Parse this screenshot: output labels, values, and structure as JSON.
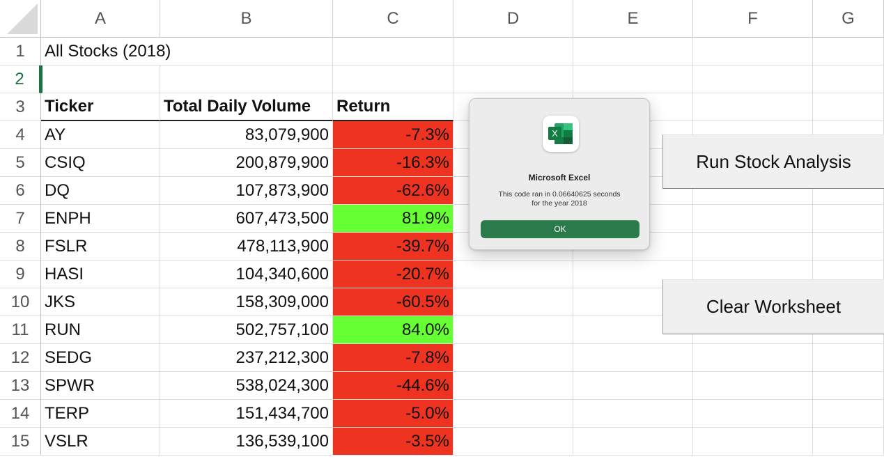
{
  "columns": [
    "A",
    "B",
    "C",
    "D",
    "E",
    "F",
    "G"
  ],
  "rows": [
    "1",
    "2",
    "3",
    "4",
    "5",
    "6",
    "7",
    "8",
    "9",
    "10",
    "11",
    "12",
    "13",
    "14",
    "15"
  ],
  "sheet": {
    "title": "All Stocks (2018)",
    "headers": {
      "ticker": "Ticker",
      "volume": "Total Daily Volume",
      "return": "Return"
    },
    "data": [
      {
        "ticker": "AY",
        "volume": "83,079,900",
        "return": "-7.3%",
        "status": "neg"
      },
      {
        "ticker": "CSIQ",
        "volume": "200,879,900",
        "return": "-16.3%",
        "status": "neg"
      },
      {
        "ticker": "DQ",
        "volume": "107,873,900",
        "return": "-62.6%",
        "status": "neg"
      },
      {
        "ticker": "ENPH",
        "volume": "607,473,500",
        "return": "81.9%",
        "status": "pos"
      },
      {
        "ticker": "FSLR",
        "volume": "478,113,900",
        "return": "-39.7%",
        "status": "neg"
      },
      {
        "ticker": "HASI",
        "volume": "104,340,600",
        "return": "-20.7%",
        "status": "neg"
      },
      {
        "ticker": "JKS",
        "volume": "158,309,000",
        "return": "-60.5%",
        "status": "neg"
      },
      {
        "ticker": "RUN",
        "volume": "502,757,100",
        "return": "84.0%",
        "status": "pos"
      },
      {
        "ticker": "SEDG",
        "volume": "237,212,300",
        "return": "-7.8%",
        "status": "neg"
      },
      {
        "ticker": "SPWR",
        "volume": "538,024,300",
        "return": "-44.6%",
        "status": "neg"
      },
      {
        "ticker": "TERP",
        "volume": "151,434,700",
        "return": "-5.0%",
        "status": "neg"
      },
      {
        "ticker": "VSLR",
        "volume": "136,539,100",
        "return": "-3.5%",
        "status": "neg"
      }
    ]
  },
  "buttons": {
    "run": "Run Stock Analysis",
    "clear": "Clear Worksheet"
  },
  "dialog": {
    "icon": "excel-app-icon",
    "icon_letter": "X",
    "title": "Microsoft Excel",
    "message_line1": "This code ran in 0.06640625 seconds",
    "message_line2": "for the year 2018",
    "ok": "OK"
  },
  "colors": {
    "negative": "#ee3421",
    "positive": "#66ff33",
    "excel_green": "#1e7145",
    "ok_button": "#2b7a4b"
  }
}
